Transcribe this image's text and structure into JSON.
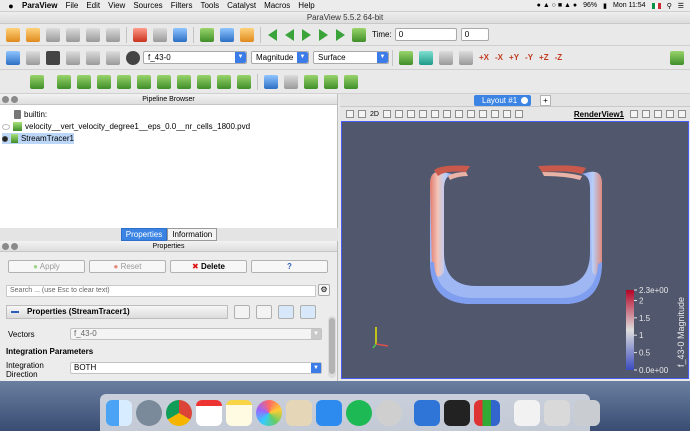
{
  "menubar": {
    "app": "ParaView",
    "items": [
      "File",
      "Edit",
      "View",
      "Sources",
      "Filters",
      "Tools",
      "Catalyst",
      "Macros",
      "Help"
    ],
    "battery": "96%",
    "clock": "Mon 11:54"
  },
  "window": {
    "title": "ParaView 5.5.2 64-bit"
  },
  "toolbar1": {
    "time_label": "Time:",
    "time_value": "0",
    "time_step": "0"
  },
  "toolbar2": {
    "array_value": "f_43-0",
    "component_value": "Magnitude",
    "representation_value": "Surface",
    "axis_buttons": [
      "+X",
      "-X",
      "+Y",
      "-Y",
      "+Z",
      "-Z"
    ]
  },
  "pipeline": {
    "title": "Pipeline Browser",
    "items": [
      {
        "label": "builtin:"
      },
      {
        "label": "velocity__vert_velocity_degree1__eps_0.0__nr_cells_1800.pvd"
      },
      {
        "label": "StreamTracer1"
      }
    ]
  },
  "tabs": {
    "properties": "Properties",
    "information": "Information"
  },
  "properties": {
    "title": "Properties",
    "apply": "Apply",
    "reset": "Reset",
    "delete": "Delete",
    "help": "?",
    "search_placeholder": "Search ... (use Esc to clear text)",
    "group_title": "Properties (StreamTracer1)",
    "vectors_label": "Vectors",
    "vectors_value": "f_43-0",
    "integration_header": "Integration Parameters",
    "integration_direction_label": "Integration Direction",
    "integration_direction_value": "BOTH"
  },
  "layout": {
    "tab": "Layout #1",
    "plus": "+",
    "render_view": "RenderView1",
    "view_2d": "2D"
  },
  "colorbar": {
    "title": "f_43-0 Magnitude",
    "ticks": [
      "2.3e+00",
      "2",
      "1.5",
      "1",
      "0.5",
      "0.0e+00"
    ],
    "tick_values": [
      2.3,
      2,
      1.5,
      1,
      0.5,
      0
    ],
    "range": [
      0,
      2.3
    ]
  },
  "colors": {
    "accent": "#3b84e4",
    "viewport_bg": "#51576d",
    "low": "#3b4cc0",
    "high": "#b40426"
  }
}
